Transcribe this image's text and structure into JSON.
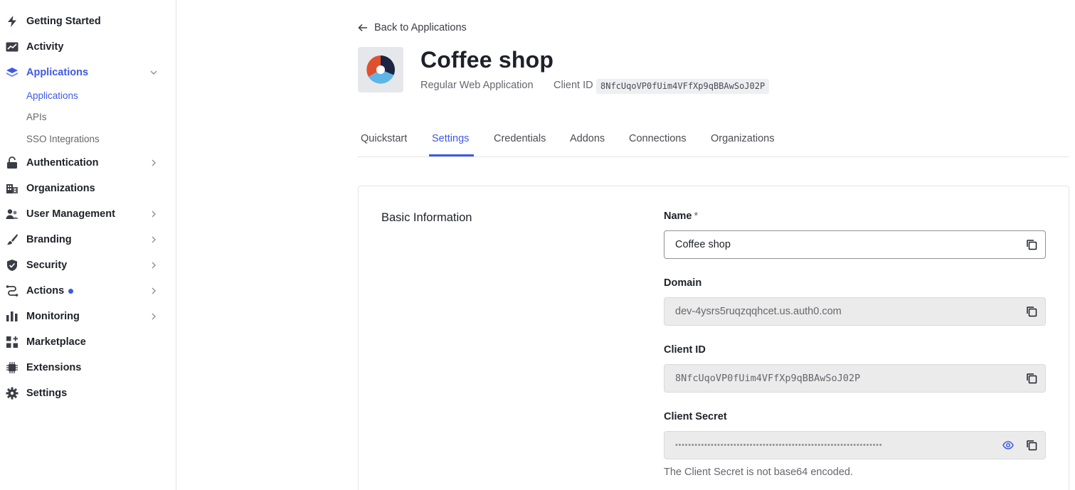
{
  "sidebar": {
    "items": [
      {
        "label": "Getting Started",
        "icon": "lightning-icon"
      },
      {
        "label": "Activity",
        "icon": "activity-chart-icon"
      },
      {
        "label": "Applications",
        "icon": "layers-icon",
        "expanded": true,
        "active": true
      },
      {
        "label": "Authentication",
        "icon": "lock-icon"
      },
      {
        "label": "Organizations",
        "icon": "building-icon"
      },
      {
        "label": "User Management",
        "icon": "users-icon"
      },
      {
        "label": "Branding",
        "icon": "brush-icon"
      },
      {
        "label": "Security",
        "icon": "shield-icon"
      },
      {
        "label": "Actions",
        "icon": "flow-icon",
        "badge_dot": true
      },
      {
        "label": "Monitoring",
        "icon": "bar-chart-icon"
      },
      {
        "label": "Marketplace",
        "icon": "grid-plus-icon"
      },
      {
        "label": "Extensions",
        "icon": "chip-icon"
      },
      {
        "label": "Settings",
        "icon": "gear-icon"
      }
    ],
    "sub_items": [
      {
        "label": "Applications",
        "active": true
      },
      {
        "label": "APIs"
      },
      {
        "label": "SSO Integrations"
      }
    ]
  },
  "header": {
    "back_label": "Back to Applications",
    "app_name": "Coffee shop",
    "app_type": "Regular Web Application",
    "client_id_label": "Client ID",
    "client_id": "8NfcUqoVP0fUim4VFfXp9qBBAwSoJ02P"
  },
  "tabs": [
    {
      "label": "Quickstart"
    },
    {
      "label": "Settings",
      "active": true
    },
    {
      "label": "Credentials"
    },
    {
      "label": "Addons"
    },
    {
      "label": "Connections"
    },
    {
      "label": "Organizations"
    }
  ],
  "basic_info": {
    "title": "Basic Information",
    "name_label": "Name",
    "required_mark": "*",
    "name_value": "Coffee shop",
    "domain_label": "Domain",
    "domain_value": "dev-4ysrs5ruqzqqhcet.us.auth0.com",
    "client_id_label": "Client ID",
    "client_id_value": "8NfcUqoVP0fUim4VFfXp9qBBAwSoJ02P",
    "client_secret_label": "Client Secret",
    "client_secret_masked": "••••••••••••••••••••••••••••••••••••••••••••••••••••••••••••••••",
    "client_secret_hint": "The Client Secret is not base64 encoded."
  },
  "colors": {
    "accent": "#3f59e4",
    "text": "#1e212a",
    "muted": "#65676e",
    "readonly_bg": "#ebebeb"
  }
}
